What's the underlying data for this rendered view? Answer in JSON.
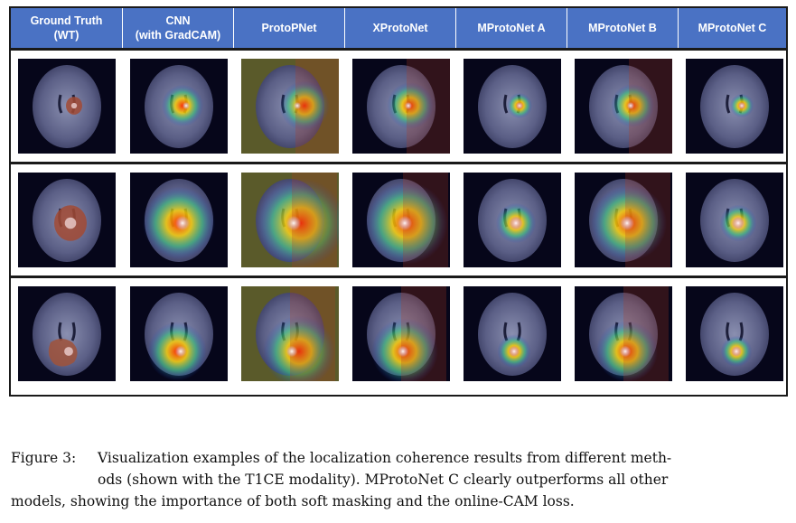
{
  "columns": [
    {
      "label": "Ground Truth\n(WT)"
    },
    {
      "label": "CNN\n(with GradCAM)"
    },
    {
      "label": "ProtoPNet"
    },
    {
      "label": "XProtoNet"
    },
    {
      "label": "MProtoNet A"
    },
    {
      "label": "MProtoNet B"
    },
    {
      "label": "MProtoNet C"
    }
  ],
  "caption": {
    "label": "Figure 3:",
    "line1": "Visualization examples of the localization coherence results from different meth-",
    "line2": "ods (shown with the T1CE modality). MProtoNet C clearly outperforms all other",
    "line3": "models, showing the importance of both soft masking and the online-CAM loss."
  }
}
